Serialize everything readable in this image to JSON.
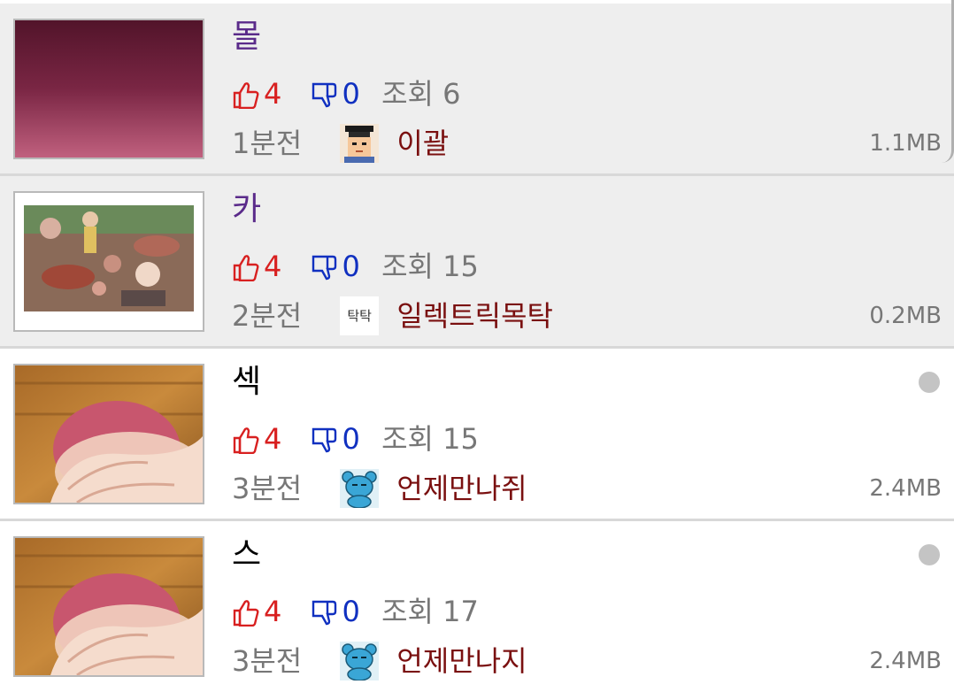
{
  "posts": [
    {
      "title": "몰",
      "likes": "4",
      "dislikes": "0",
      "views": "조회 6",
      "time": "1분전",
      "author": "이괄",
      "avatar": "graduate-avatar-icon",
      "size": "1.1MB",
      "thumbnail": "maroon-gradient-image",
      "unread": false
    },
    {
      "title": "카",
      "likes": "4",
      "dislikes": "0",
      "views": "조회 15",
      "time": "2분전",
      "author": "일렉트릭목탁",
      "avatar_text": "탁탁",
      "size": "0.2MB",
      "thumbnail": "crowd-scene-image",
      "unread": false
    },
    {
      "title": "섹",
      "likes": "4",
      "dislikes": "0",
      "views": "조회 15",
      "time": "3분전",
      "author": "언제만나쥐",
      "avatar": "blue-bear-avatar-icon",
      "size": "2.4MB",
      "thumbnail": "hand-holding-ball-image",
      "unread": true
    },
    {
      "title": "스",
      "likes": "4",
      "dislikes": "0",
      "views": "조회 17",
      "time": "3분전",
      "author": "언제만나지",
      "avatar": "blue-bear-avatar-icon",
      "size": "2.4MB",
      "thumbnail": "hand-holding-ball-image",
      "unread": true
    }
  ],
  "colors": {
    "like": "#d82020",
    "dislike": "#1030c0",
    "author": "#7a1010",
    "read_title": "#5a2a8a",
    "read_bg": "#eeeeee"
  }
}
